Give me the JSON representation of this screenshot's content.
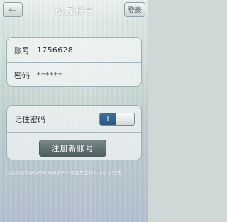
{
  "header": {
    "back_label": "⇦",
    "title": "设置账号",
    "login_label": "登录"
  },
  "account": {
    "account_label": "账号",
    "account_value": "1756628",
    "password_label": "密码",
    "password_value": "******"
  },
  "remember": {
    "label": "记住密码",
    "toggle_text": "I",
    "toggle_on": true
  },
  "register_label": "注册新账号",
  "hint": "请妥善保管好你的账号和密码以便在其它移动设备上登陆。",
  "colors": {
    "toggle_accent": "#2f6090",
    "button_dark": "#5a686b"
  }
}
